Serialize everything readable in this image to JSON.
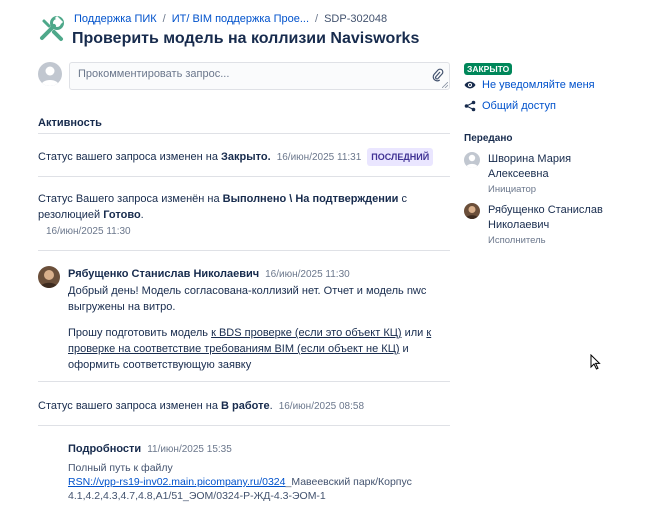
{
  "header": {
    "breadcrumb": [
      "Поддержка ПИК",
      "ИТ/ BIM поддержка Прое...",
      "SDP-302048"
    ],
    "separator": "/",
    "title": "Проверить модель на коллизии Navisworks"
  },
  "comment_input": {
    "placeholder": "Прокомментировать запрос..."
  },
  "activity": {
    "heading": "Активность",
    "entries": [
      {
        "prefix": "Статус вашего запроса изменен на ",
        "status": "Закрыто.",
        "time": "16/июн/2025 11:31",
        "badge": "ПОСЛЕДНИЙ"
      },
      {
        "prefix": "Статус Вашего запроса изменён на ",
        "status": "Выполнено \\ На подтверждении",
        "middle": " с резолюцией ",
        "resolution": "Готово",
        "suffix": ".",
        "time": "16/июн/2025 11:30"
      },
      {
        "author": "Рябущенко Станислав Николаевич",
        "time": "16/июн/2025 11:30",
        "para1": "Добрый день! Модель согласована-коллизий нет. Отчет и модель nwc выгружены на витро.",
        "para2_a": "Прошу подготовить модель ",
        "para2_link1": "к BDS проверке (если это объект КЦ)",
        "para2_b": " или ",
        "para2_link2": "к проверке на соответствие требованиям BIM (если объект не КЦ)",
        "para2_c": " и оформить соответствующую заявку"
      },
      {
        "prefix": "Статус вашего запроса изменен на ",
        "status": "В работе",
        "suffix": ".",
        "time": "16/июн/2025 08:58"
      }
    ],
    "details": {
      "label": "Подробности",
      "time": "11/июн/2025 15:35",
      "path_label": "Полный путь к файлу",
      "path_link": "RSN://vpp-rs19-inv02.main.picompany.ru/0324",
      "path_rest": "_Мавеевский парк/Корпус 4.1,4.2,4.3,4.7,4.8,А1/51_ЭОМ/0324-Р-ЖД-4.3-ЭОМ-1"
    }
  },
  "sidebar": {
    "status": "ЗАКРЫТО",
    "notify": "Не уведомляйте меня",
    "share": "Общий доступ",
    "shared_heading": "Передано",
    "people": [
      {
        "name": "Шворина Мария Алексеевна",
        "role": "Инициатор"
      },
      {
        "name": "Рябущенко Станислав Николаевич",
        "role": "Исполнитель"
      }
    ]
  },
  "colors": {
    "link": "#0052cc",
    "status_closed": "#00875a",
    "badge_latest_bg": "#eae6ff",
    "icon_logo": "#4ea88a"
  },
  "icons": [
    "tools-logo-icon",
    "paperclip-icon",
    "eye-icon",
    "share-icon",
    "avatar-icon",
    "cursor-icon"
  ]
}
